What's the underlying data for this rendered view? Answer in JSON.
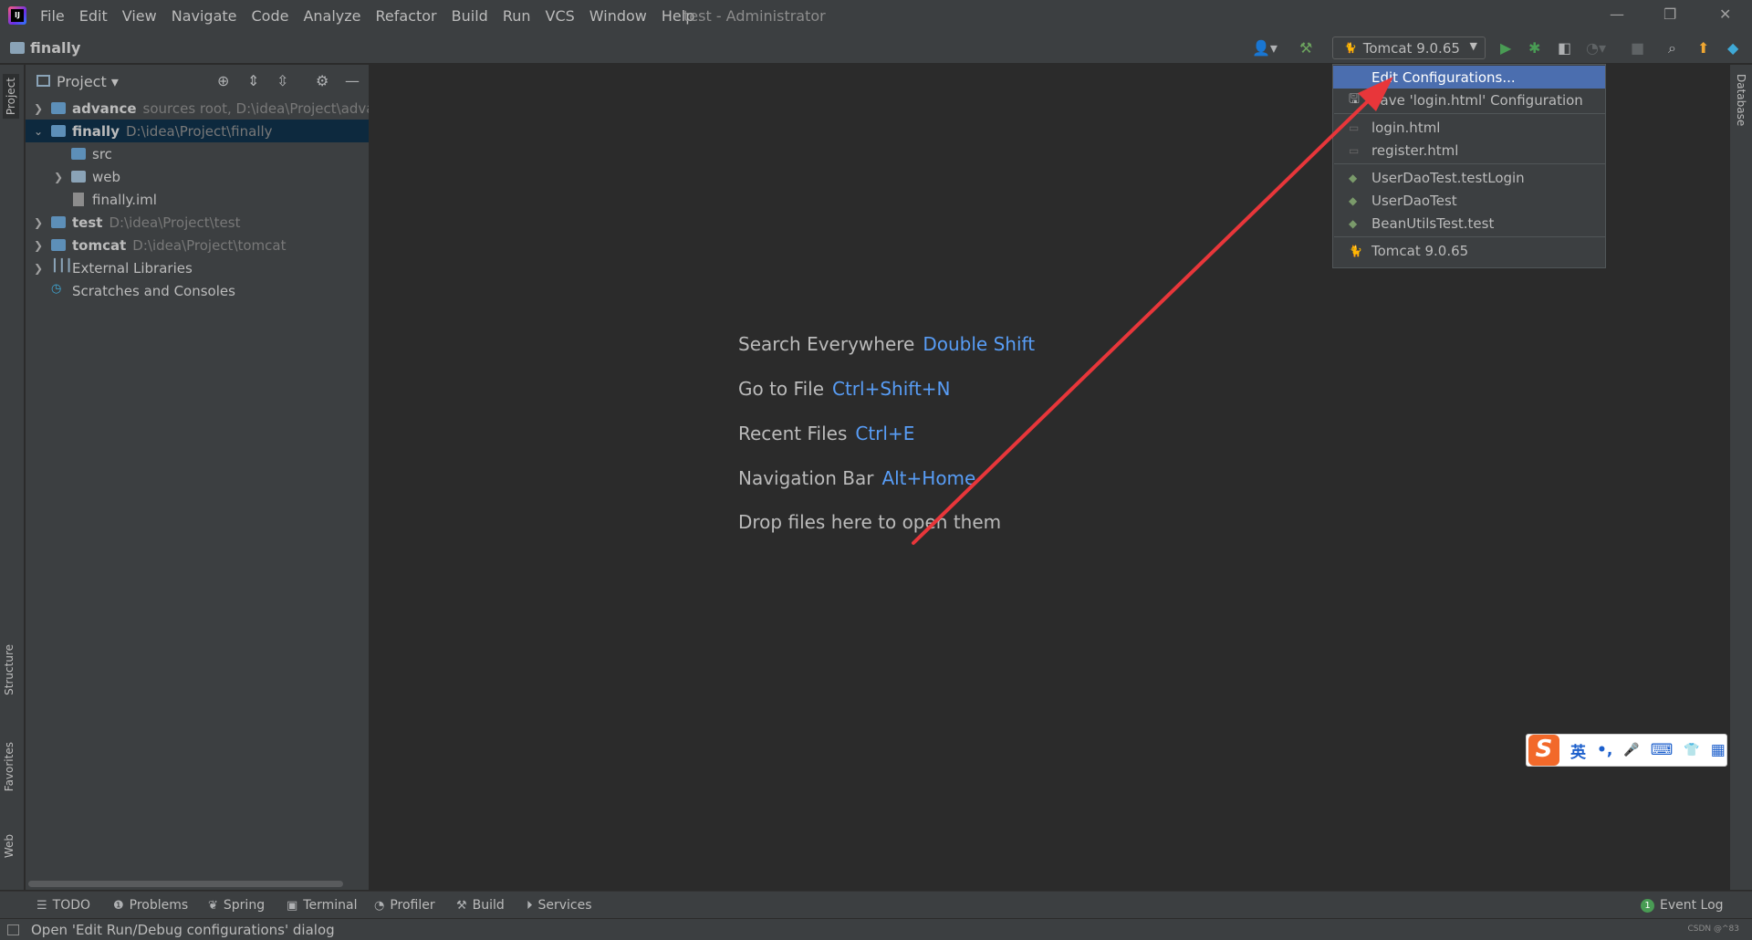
{
  "window": {
    "title": "test - Administrator",
    "minimize_glyph": "—",
    "restore_glyph": "❐",
    "close_glyph": "✕"
  },
  "menu": [
    "File",
    "Edit",
    "View",
    "Navigate",
    "Code",
    "Analyze",
    "Refactor",
    "Build",
    "Run",
    "VCS",
    "Window",
    "Help"
  ],
  "breadcrumb": {
    "project": "finally"
  },
  "toolbar": {
    "run_config": "Tomcat 9.0.65"
  },
  "side_tabs": {
    "project": "Project",
    "structure": "Structure",
    "favorites": "Favorites",
    "web": "Web",
    "database": "Database"
  },
  "project_panel": {
    "title": "Project",
    "tree": [
      {
        "name": "advance",
        "detail": "sources root,  D:\\idea\\Project\\adva",
        "bold": true,
        "expanded": false
      },
      {
        "name": "finally",
        "detail": "D:\\idea\\Project\\finally",
        "bold": true,
        "expanded": true
      },
      {
        "name": "src",
        "detail": ""
      },
      {
        "name": "web",
        "detail": ""
      },
      {
        "name": "finally.iml",
        "detail": ""
      },
      {
        "name": "test",
        "detail": "D:\\idea\\Project\\test",
        "bold": true
      },
      {
        "name": "tomcat",
        "detail": "D:\\idea\\Project\\tomcat",
        "bold": true
      },
      {
        "name": "External Libraries",
        "detail": ""
      },
      {
        "name": "Scratches and Consoles",
        "detail": ""
      }
    ]
  },
  "editor_hints": [
    {
      "label": "Search Everywhere",
      "key": "Double Shift"
    },
    {
      "label": "Go to File",
      "key": "Ctrl+Shift+N"
    },
    {
      "label": "Recent Files",
      "key": "Ctrl+E"
    },
    {
      "label": "Navigation Bar",
      "key": "Alt+Home"
    },
    {
      "label": "Drop files here to open them",
      "key": ""
    }
  ],
  "run_config_popup": {
    "items": [
      {
        "label": "Edit Configurations...",
        "icon": "none"
      },
      {
        "label": "Save 'login.html' Configuration",
        "icon": "save-icon"
      },
      {
        "label": "login.html",
        "icon": "html-icon"
      },
      {
        "label": "register.html",
        "icon": "html-icon"
      },
      {
        "label": "UserDaoTest.testLogin",
        "icon": "test-icon"
      },
      {
        "label": "UserDaoTest",
        "icon": "test-icon"
      },
      {
        "label": "BeanUtilsTest.test",
        "icon": "test-icon"
      },
      {
        "label": "Tomcat 9.0.65",
        "icon": "tomcat-icon"
      }
    ]
  },
  "ime": {
    "logo": "S",
    "mode": "英",
    "punct": "•,",
    "mic": "🎤",
    "keyboard": "⌨",
    "skin": "👕",
    "apps": "▦"
  },
  "bottom_tabs": {
    "todo": "TODO",
    "problems": "Problems",
    "spring": "Spring",
    "terminal": "Terminal",
    "profiler": "Profiler",
    "build": "Build",
    "services": "Services",
    "event_log": "Event Log",
    "event_log_count": "1"
  },
  "status": {
    "message": "Open 'Edit Run/Debug configurations' dialog",
    "watermark": "CSDN @^83"
  },
  "colors": {
    "accent_key": "#589df6",
    "selection": "#4b6eaf",
    "annotation_arrow": "#e8363a"
  }
}
